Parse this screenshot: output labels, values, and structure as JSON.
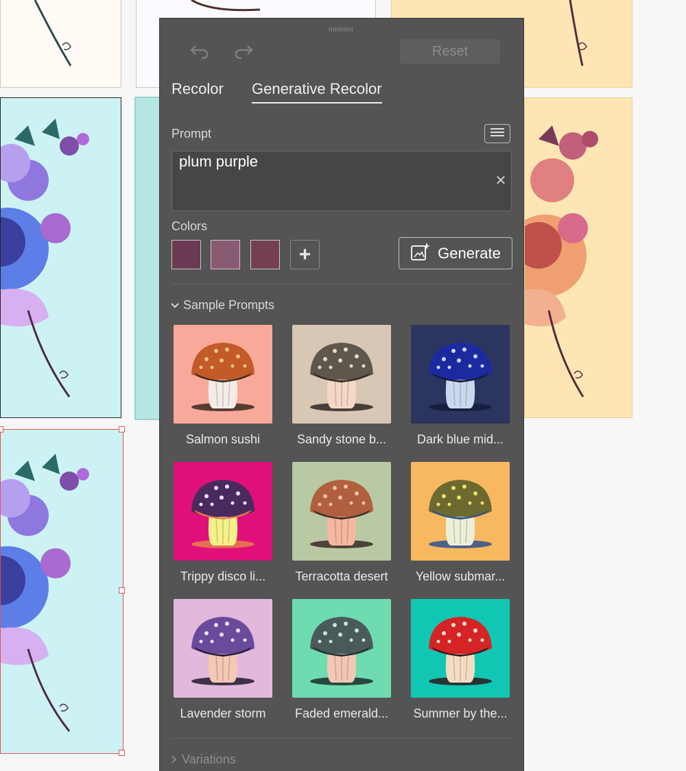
{
  "toolbar": {
    "undo_icon": "undo-icon",
    "redo_icon": "redo-icon",
    "reset_label": "Reset"
  },
  "tabs": [
    {
      "label": "Recolor",
      "active": false
    },
    {
      "label": "Generative Recolor",
      "active": true
    }
  ],
  "prompt": {
    "label": "Prompt",
    "value": "plum purple",
    "menu_icon": "menu-icon",
    "clear_icon": "close-icon"
  },
  "colors": {
    "label": "Colors",
    "swatches": [
      "#6b3a52",
      "#8a5a72",
      "#74404f"
    ],
    "add_icon": "plus-icon"
  },
  "generate": {
    "label": "Generate",
    "icon": "generate-sparkle-icon"
  },
  "sample_prompts": {
    "label": "Sample Prompts",
    "items": [
      {
        "label": "Salmon sushi",
        "bg": "#f8a99a",
        "cap": "#c25a2a",
        "dots": "#f0c080",
        "stem": "#f4ece8",
        "band": "#3a2a1e"
      },
      {
        "label": "Sandy stone b...",
        "bg": "#d8c7b5",
        "cap": "#5f564c",
        "dots": "#e8dcc8",
        "stem": "#f4d7c4",
        "band": "#2d2824"
      },
      {
        "label": "Dark blue mid...",
        "bg": "#2b3560",
        "cap": "#1c2aa0",
        "dots": "#cfd6ff",
        "stem": "#c9d8ee",
        "band": "#141a3a"
      },
      {
        "label": "Trippy disco li...",
        "bg": "#e0107a",
        "cap": "#4a2a5e",
        "dots": "#f6e6ff",
        "stem": "#f7f08a",
        "band": "#e6804a"
      },
      {
        "label": "Terracotta desert",
        "bg": "#b8c9a4",
        "cap": "#b0603e",
        "dots": "#f2c0a0",
        "stem": "#f4b8a0",
        "band": "#3a2a24"
      },
      {
        "label": "Yellow submar...",
        "bg": "#f8b860",
        "cap": "#6c6a30",
        "dots": "#f0e06a",
        "stem": "#eceed8",
        "band": "#2e5090"
      },
      {
        "label": "Lavender storm",
        "bg": "#e2b8dc",
        "cap": "#6a4a9a",
        "dots": "#ece4ff",
        "stem": "#f4c8b4",
        "band": "#221a2e"
      },
      {
        "label": "Faded emerald...",
        "bg": "#6edcb0",
        "cap": "#4a5a5a",
        "dots": "#c8e6d8",
        "stem": "#f2c8b4",
        "band": "#202c2c"
      },
      {
        "label": "Summer by the...",
        "bg": "#12c6b4",
        "cap": "#d42424",
        "dots": "#f8e0d8",
        "stem": "#f4dcc4",
        "band": "#2c1a1a"
      }
    ]
  },
  "variations": {
    "label": "Variations"
  }
}
